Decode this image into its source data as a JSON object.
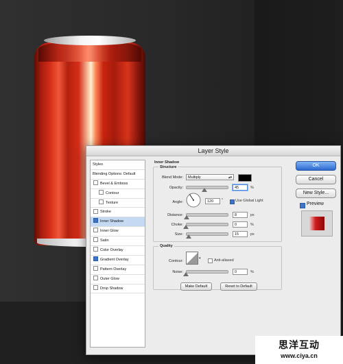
{
  "dialog": {
    "title": "Layer Style"
  },
  "styles_panel": {
    "items": [
      {
        "label": "Styles",
        "checkbox": false,
        "checked": false,
        "level": "hdr",
        "selected": false
      },
      {
        "label": "Blending Options: Default",
        "checkbox": false,
        "checked": false,
        "level": "hdr",
        "selected": false
      },
      {
        "label": "Bevel & Emboss",
        "checkbox": true,
        "checked": false,
        "level": "l1",
        "selected": false
      },
      {
        "label": "Contour",
        "checkbox": true,
        "checked": false,
        "level": "l2",
        "selected": false
      },
      {
        "label": "Texture",
        "checkbox": true,
        "checked": false,
        "level": "l2",
        "selected": false
      },
      {
        "label": "Stroke",
        "checkbox": true,
        "checked": false,
        "level": "l1",
        "selected": false
      },
      {
        "label": "Inner Shadow",
        "checkbox": true,
        "checked": true,
        "level": "l1",
        "selected": true
      },
      {
        "label": "Inner Glow",
        "checkbox": true,
        "checked": false,
        "level": "l1",
        "selected": false
      },
      {
        "label": "Satin",
        "checkbox": true,
        "checked": false,
        "level": "l1",
        "selected": false
      },
      {
        "label": "Color Overlay",
        "checkbox": true,
        "checked": false,
        "level": "l1",
        "selected": false
      },
      {
        "label": "Gradient Overlay",
        "checkbox": true,
        "checked": true,
        "level": "l1",
        "selected": false
      },
      {
        "label": "Pattern Overlay",
        "checkbox": true,
        "checked": false,
        "level": "l1",
        "selected": false
      },
      {
        "label": "Outer Glow",
        "checkbox": true,
        "checked": false,
        "level": "l1",
        "selected": false
      },
      {
        "label": "Drop Shadow",
        "checkbox": true,
        "checked": false,
        "level": "l1",
        "selected": false
      }
    ]
  },
  "inner_shadow": {
    "heading": "Inner Shadow",
    "structure_label": "Structure",
    "blend_mode": {
      "label": "Blend Mode:",
      "value": "Multiply",
      "color": "#000000"
    },
    "opacity": {
      "label": "Opacity:",
      "value": "45",
      "unit": "%",
      "level": 0.45
    },
    "angle": {
      "label": "Angle:",
      "value": "120",
      "unit": "°",
      "global_light_label": "Use Global Light",
      "global_light": true
    },
    "distance": {
      "label": "Distance:",
      "value": "8",
      "unit": "px",
      "level": 0.02
    },
    "choke": {
      "label": "Choke:",
      "value": "0",
      "unit": "%",
      "level": 0
    },
    "size": {
      "label": "Size:",
      "value": "15",
      "unit": "px",
      "level": 0.06
    },
    "quality_label": "Quality",
    "contour": {
      "label": "Contour:",
      "anti_aliased_label": "Anti-aliased",
      "anti_aliased": false
    },
    "noise": {
      "label": "Noise:",
      "value": "0",
      "unit": "%",
      "level": 0
    },
    "make_default_label": "Make Default",
    "reset_default_label": "Reset to Default"
  },
  "right_buttons": {
    "ok": "OK",
    "cancel": "Cancel",
    "new_style": "New Style...",
    "preview_label": "Preview",
    "preview_checked": true
  },
  "watermark": {
    "chinese": "思洋互动",
    "url": "www.ciya.cn"
  },
  "colors": {
    "accent": "#3c75c8",
    "can_red": "#c9240f",
    "selection": "#c6d9f2"
  }
}
